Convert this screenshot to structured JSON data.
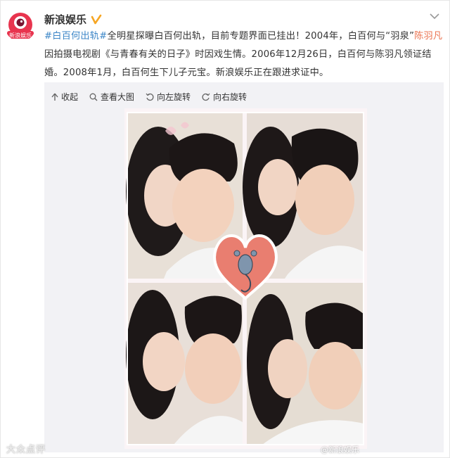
{
  "author": {
    "name": "新浪娱乐",
    "avatar_text": "新浪娱乐"
  },
  "post": {
    "hashtag": "#白百何出轨#",
    "text_1": "全明星探曝白百何出轨，目前专题界面已挂出！2004年，白百何与“羽泉”",
    "mention": "陈羽凡",
    "text_2": "因拍摄电视剧《与青春有关的日子》时因戏生情。2006年12月26日，白百何与陈羽凡领证结婚。2008年1月，白百何生下儿子元宝。新浪娱乐正在跟进求证中。"
  },
  "toolbar": {
    "collapse": "收起",
    "view_large": "查看大图",
    "rotate_left": "向左旋转",
    "rotate_right": "向右旋转"
  },
  "watermarks": {
    "left": "大众点评",
    "right": "@新浪娱乐"
  },
  "colors": {
    "link": "#eb7350",
    "hashtag": "#3c86c7",
    "verified": "#f6a623"
  }
}
